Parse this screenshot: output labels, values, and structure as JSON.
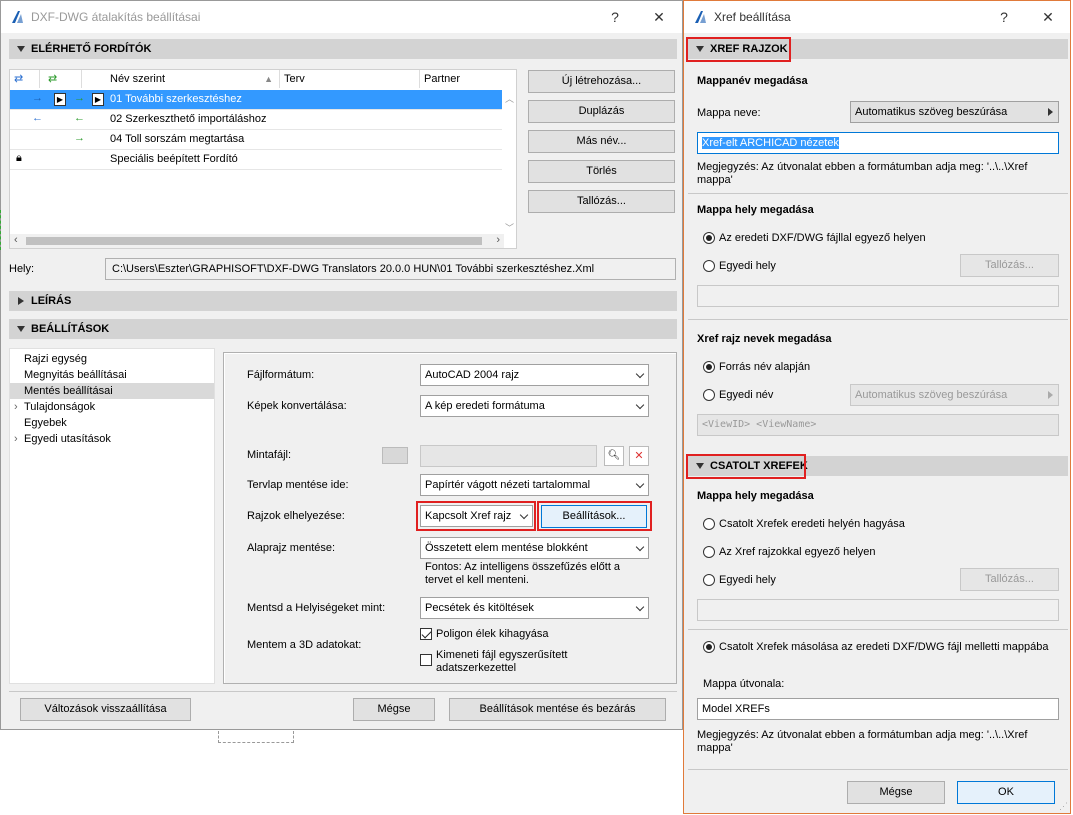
{
  "main": {
    "title": "DXF-DWG átalakítás beállításai",
    "help": "?",
    "close": "✕",
    "translators_header": "ELÉRHETŐ FORDÍTÓK",
    "columns": [
      "Név szerint",
      "Terv",
      "Partner"
    ],
    "rows": [
      {
        "name": "01 További szerkesztéshez"
      },
      {
        "name": "02 Szerkeszthető importáláshoz"
      },
      {
        "name": "04 Toll sorszám megtartása"
      },
      {
        "name": "Speciális beépített Fordító"
      }
    ],
    "side_buttons": [
      "Új létrehozása...",
      "Duplázás",
      "Más név...",
      "Törlés",
      "Tallózás..."
    ],
    "path_label": "Hely:",
    "path_value": "C:\\Users\\Eszter\\GRAPHISOFT\\DXF-DWG Translators 20.0.0 HUN\\01 További szerkesztéshez.Xml",
    "description_header": "LEÍRÁS",
    "settings_header": "BEÁLLÍTÁSOK",
    "tree": [
      "Rajzi egység",
      "Megnyitás beállításai",
      "Mentés beállításai",
      "Tulajdonságok",
      "Egyebek",
      "Egyedi utasítások"
    ],
    "form": {
      "file_format_label": "Fájlformátum:",
      "file_format_value": "AutoCAD 2004 rajz",
      "images_label": "Képek konvertálása:",
      "images_value": "A kép eredeti formátuma",
      "template_label": "Mintafájl:",
      "layout_label": "Tervlap mentése ide:",
      "layout_value": "Papírtér vágott nézeti tartalommal",
      "drawings_label": "Rajzok elhelyezése:",
      "drawings_value": "Kapcsolt Xref rajz",
      "settings_button": "Beállítások...",
      "floorplan_label": "Alaprajz mentése:",
      "floorplan_value": "Összetett elem mentése blokként",
      "floorplan_note": "Fontos: Az intelligens összefűzés előtt a tervet el kell menteni.",
      "zones_label": "Mentsd a Helyiségeket mint:",
      "zones_value": "Pecsétek és kitöltések",
      "data3d_label": "Mentem a 3D adatokat:",
      "poly_label": "Poligon élek kihagyása",
      "simplified_label": "Kimeneti fájl egyszerűsített adatszerkezettel"
    },
    "reset_button": "Változások visszaállítása",
    "cancel_button": "Mégse",
    "save_button": "Beállítások mentése és bezárás"
  },
  "xref": {
    "title": "Xref beállítása",
    "help": "?",
    "close": "✕",
    "section1": "XREF RAJZOK",
    "folder_name_header": "Mappanév megadása",
    "folder_name_label": "Mappa neve:",
    "auto_text": "Automatikus szöveg beszúrása",
    "folder_name_value": "Xref-elt ARCHICAD nézetek",
    "note1": "Megjegyzés: Az útvonalat ebben a formátumban adja meg:   '..\\..\\Xref mappa'",
    "folder_loc_header": "Mappa hely megadása",
    "loc_opt1": "Az eredeti DXF/DWG fájllal egyező helyen",
    "loc_opt2": "Egyedi hely",
    "browse": "Tallózás...",
    "names_header": "Xref rajz nevek megadása",
    "name_opt1": "Forrás név alapján",
    "name_opt2": "Egyedi név",
    "auto_text2": "Automatikus szöveg beszúrása",
    "name_pattern": "<ViewID> <ViewName>",
    "section2": "CSATOLT XREFEK",
    "attached_loc_header": "Mappa hely megadása",
    "att_opt1": "Csatolt Xrefek eredeti helyén hagyása",
    "att_opt2": "Az Xref rajzokkal egyező helyen",
    "att_opt3": "Egyedi hely",
    "browse2": "Tallózás...",
    "att_opt4": "Csatolt Xrefek másolása az eredeti DXF/DWG fájl melletti mappába",
    "path_header": "Mappa útvonala:",
    "path_value": "Model XREFs",
    "note2": "Megjegyzés: Az útvonalat ebben a formátumban adja meg:   '..\\..\\Xref mappa'",
    "cancel": "Mégse",
    "ok": "OK"
  }
}
